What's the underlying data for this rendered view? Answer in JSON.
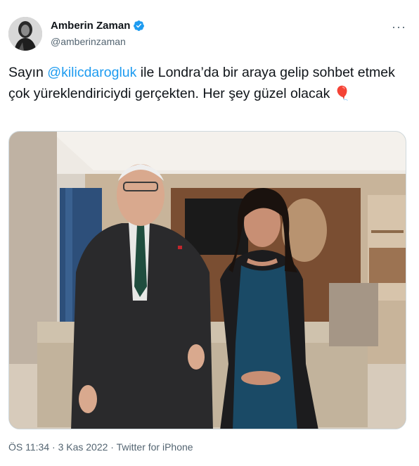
{
  "tweet": {
    "author": {
      "display_name": "Amberin Zaman",
      "handle": "@amberinzaman",
      "verified": true
    },
    "more_icon": "more-dots-icon",
    "text": {
      "prefix": "Sayın ",
      "mention": "@kilicdarogluk",
      "suffix": " ile Londra’da bir araya gelip sohbet etmek çok yüreklendiriciydi  gerçekten. Her şey güzel olacak ",
      "emoji": "🎈"
    },
    "meta": {
      "time": "ÖS 11:34",
      "separator1": " · ",
      "date": "3 Kas 2022",
      "separator2": " · ",
      "source": "Twitter for iPhone"
    },
    "colors": {
      "link": "#1d9bf0",
      "text": "#0f1419",
      "secondary": "#536471",
      "verified": "#1d9bf0"
    }
  }
}
